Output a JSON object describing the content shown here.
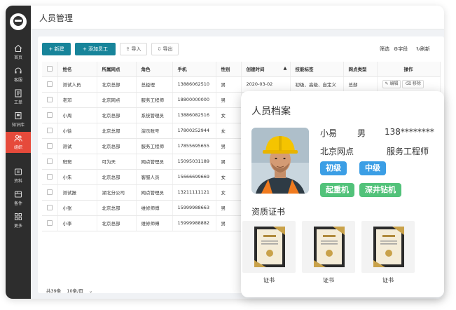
{
  "app": {
    "page_title": "人员管理"
  },
  "sidebar": {
    "items": [
      {
        "label": "首页",
        "icon": "home-icon"
      },
      {
        "label": "客服",
        "icon": "headset-icon"
      },
      {
        "label": "工单",
        "icon": "ticket-icon"
      },
      {
        "label": "知识库",
        "icon": "book-icon"
      },
      {
        "label": "组织",
        "icon": "people-icon",
        "active": true
      },
      {
        "label": "资料",
        "icon": "folder-icon"
      },
      {
        "label": "备件",
        "icon": "box-icon"
      },
      {
        "label": "更多",
        "icon": "grid-icon"
      }
    ],
    "accent_color": "#e64a3b"
  },
  "toolbar": {
    "new_label": "+ 新建",
    "add_staff_label": "+ 添加员工",
    "import_label": "导入",
    "export_label": "导出",
    "filter_label": "筛选",
    "fields_label": "字段",
    "refresh_label": "刷新",
    "primary_color": "#17849a"
  },
  "table": {
    "headers": [
      "姓名",
      "所属网点",
      "角色",
      "手机",
      "性别",
      "创建时间",
      "技能标签",
      "网点类型",
      "操作"
    ],
    "rows": [
      [
        "测试人员",
        "北京总部",
        "总经理",
        "13886062510",
        "男",
        "2020-03-02",
        "初级、高级、自定义",
        "总部"
      ],
      [
        "老邓",
        "北京网点",
        "服务工程师",
        "18800000000",
        "男",
        "",
        "",
        ""
      ],
      [
        "小周",
        "北京总部",
        "系统管理员",
        "13886082516",
        "女",
        "",
        "",
        ""
      ],
      [
        "小徐",
        "北京总部",
        "演示账号",
        "17800252944",
        "女",
        "",
        "",
        ""
      ],
      [
        "测试",
        "北京总部",
        "服务工程师",
        "17855695655",
        "男",
        "",
        "",
        ""
      ],
      [
        "斑斑",
        "可为天",
        "网点管理员",
        "15095031189",
        "男",
        "",
        "",
        ""
      ],
      [
        "小朱",
        "北京总部",
        "客服人员",
        "15666699669",
        "女",
        "",
        "",
        ""
      ],
      [
        "测试报",
        "湖北分公司",
        "网点管理员",
        "13211111121",
        "女",
        "",
        "",
        ""
      ],
      [
        "小张",
        "北京总部",
        "维修师傅",
        "15999988663",
        "男",
        "",
        "",
        ""
      ],
      [
        "小李",
        "北京总部",
        "维修师傅",
        "15999988882",
        "男",
        "",
        "",
        ""
      ]
    ],
    "edit_label": "编辑",
    "delete_label": "移除"
  },
  "pagination": {
    "total": "共39条",
    "page_size": "10条/页"
  },
  "profile": {
    "title": "人员档案",
    "name": "小易",
    "gender": "男",
    "phone": "138********",
    "org": "北京网点",
    "role": "服务工程师",
    "level_tags": [
      "初级",
      "中级"
    ],
    "skill_tags": [
      "起重机",
      "深井钻机"
    ],
    "cert_section": "资质证书",
    "certs": [
      "证书",
      "证书",
      "证书"
    ],
    "level_color": "#3b9ee5",
    "skill_color": "#52c27a"
  }
}
